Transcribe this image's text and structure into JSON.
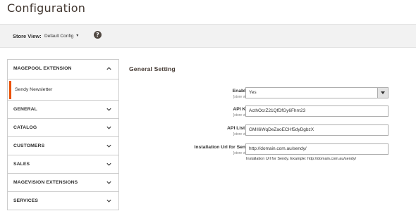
{
  "page": {
    "title": "Configuration"
  },
  "store_bar": {
    "label": "Store View:",
    "selected": "Default Config",
    "caret": "▾",
    "help": "?"
  },
  "sidebar": {
    "open_section": {
      "label": "MAGEPOOL EXTENSION",
      "icon": "chevron-up-icon"
    },
    "open_items": [
      {
        "label": "Sendy Newsletter",
        "active": true
      }
    ],
    "sections": [
      {
        "label": "GENERAL",
        "icon": "chevron-down-icon"
      },
      {
        "label": "CATALOG",
        "icon": "chevron-down-icon"
      },
      {
        "label": "CUSTOMERS",
        "icon": "chevron-down-icon"
      },
      {
        "label": "SALES",
        "icon": "chevron-down-icon"
      },
      {
        "label": "MAGEVISION EXTENSIONS",
        "icon": "chevron-down-icon"
      },
      {
        "label": "SERVICES",
        "icon": "chevron-down-icon"
      }
    ]
  },
  "form": {
    "section_title": "General Setting",
    "fields": [
      {
        "label": "Enabled",
        "scope": "[store view]",
        "value": "Yes",
        "type": "select"
      },
      {
        "label": "API Key",
        "scope": "[store view]",
        "value": "ActhOcrZ21QfDfGy6Fhm23",
        "type": "text"
      },
      {
        "label": "API List ID",
        "scope": "[store view]",
        "value": "GMIl6WqDeZaoECHf5dyDgbzX",
        "type": "text"
      },
      {
        "label": "Installation Url for Sendy",
        "scope": "[store view]",
        "value": "http://domain.com.au/sendy/",
        "type": "text",
        "note": "Installation Url for Sendy. Example: http://domain.com.au/sendy/"
      }
    ]
  },
  "colors": {
    "accent": "#eb5202",
    "bar_bg": "#f2f2f2",
    "border": "#cccccc"
  }
}
